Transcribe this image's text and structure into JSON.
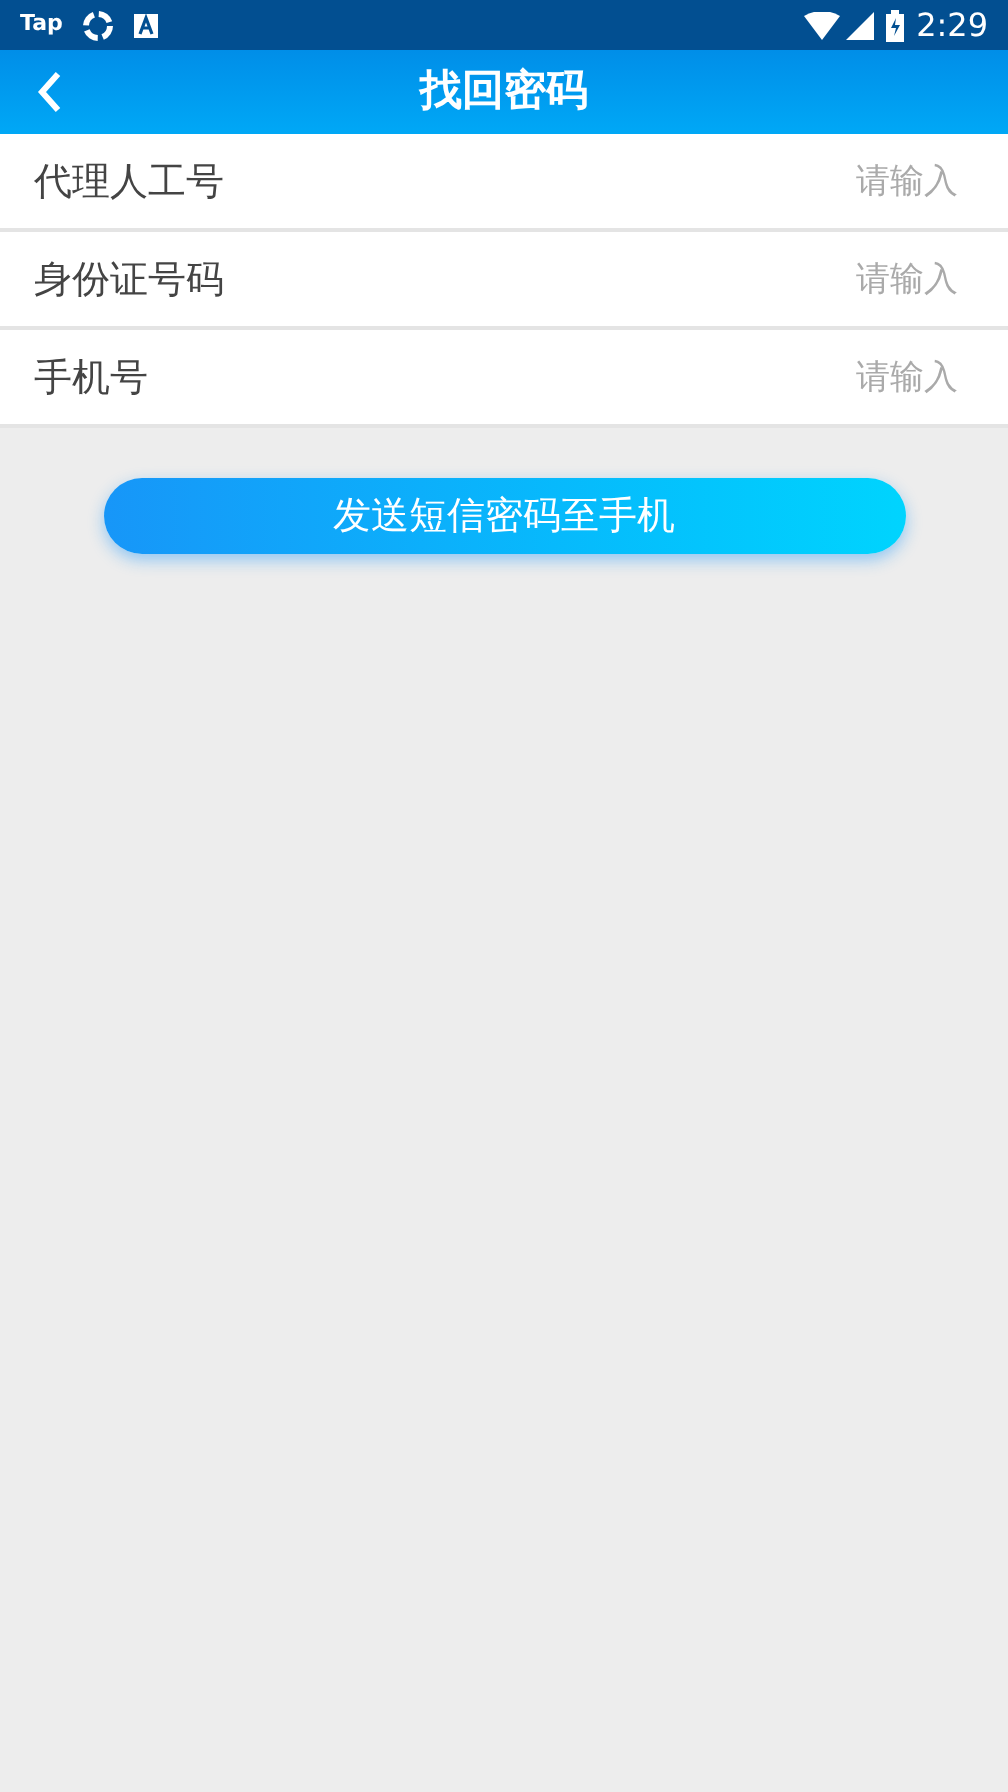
{
  "status_bar": {
    "app_label": "Tap",
    "time": "2:29"
  },
  "header": {
    "title": "找回密码"
  },
  "fields": [
    {
      "label": "代理人工号",
      "placeholder": "请输入"
    },
    {
      "label": "身份证号码",
      "placeholder": "请输入"
    },
    {
      "label": "手机号",
      "placeholder": "请输入"
    }
  ],
  "submit_button": "发送短信密码至手机"
}
